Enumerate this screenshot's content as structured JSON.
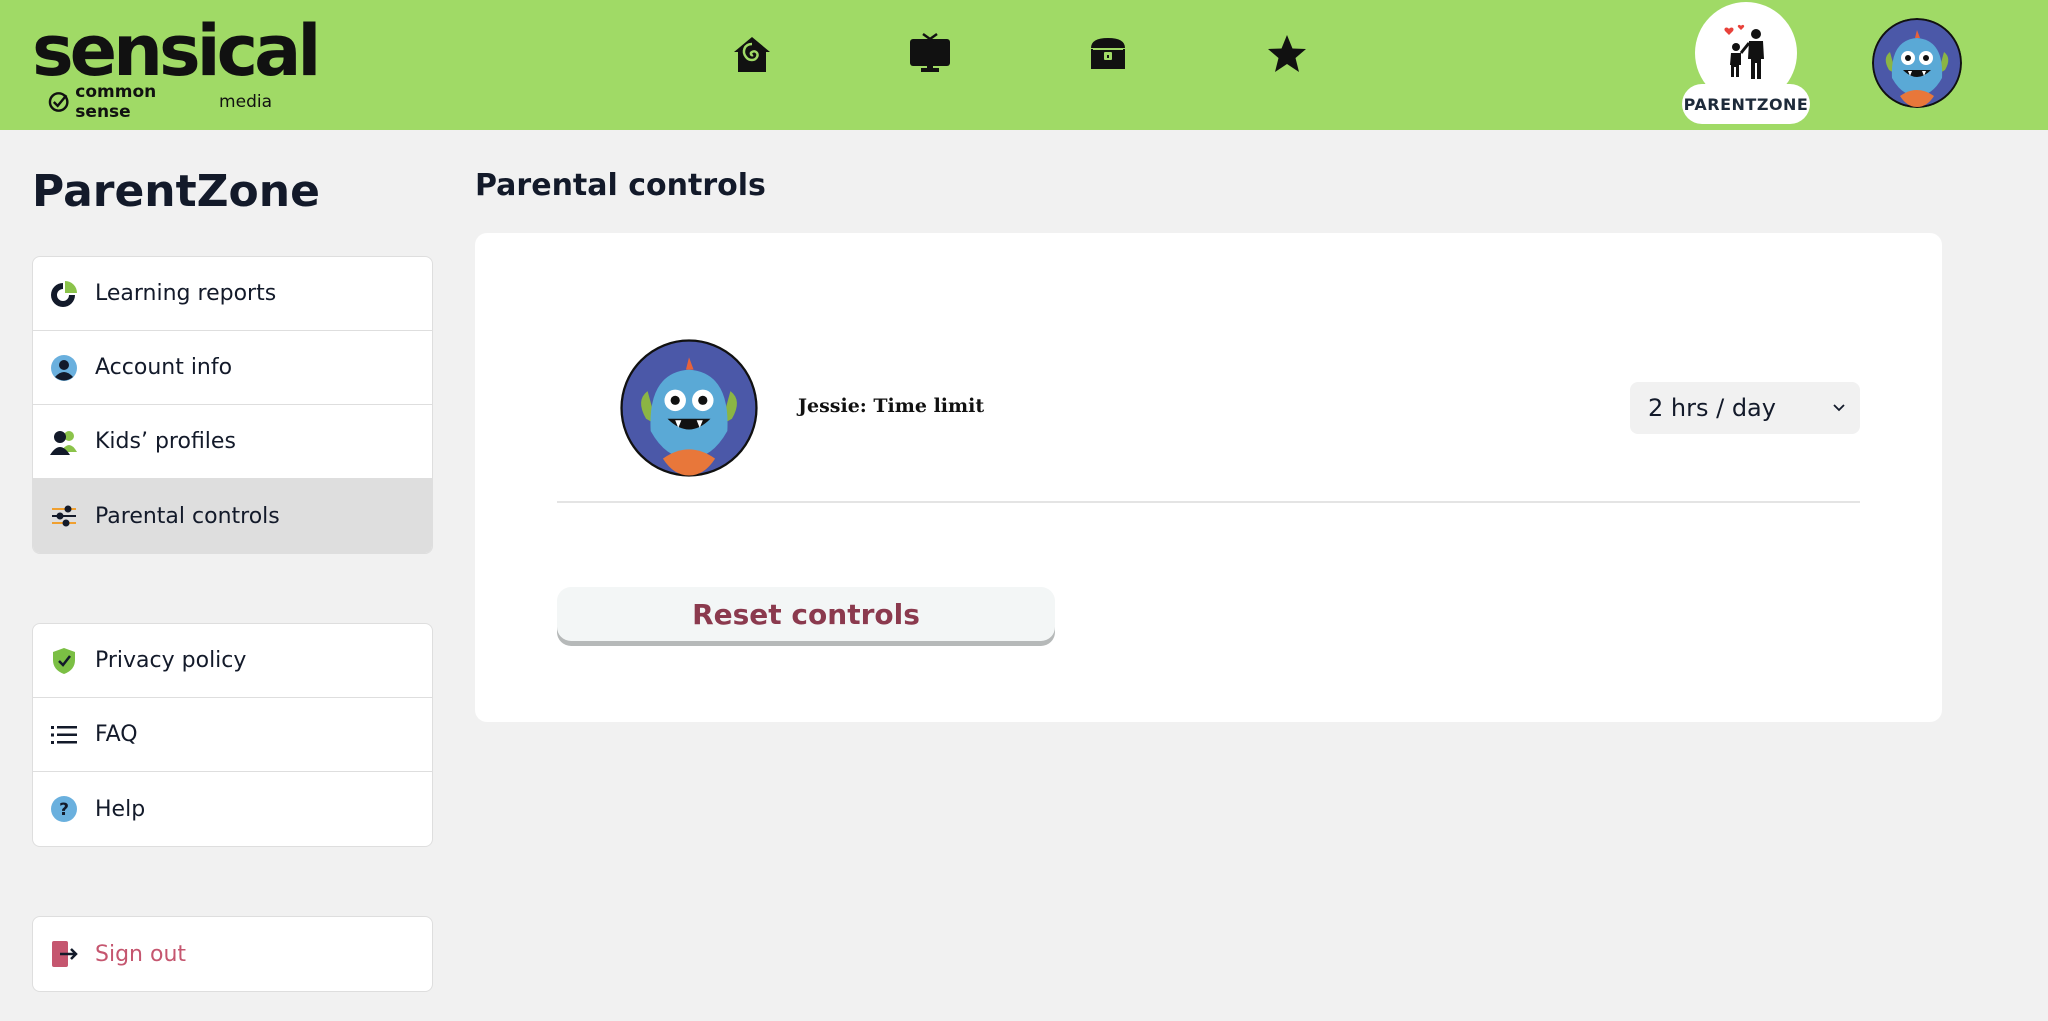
{
  "header": {
    "logo_main": "sensical",
    "logo_sub_brand": "common sense",
    "logo_sub_media": "media",
    "nav_icons": [
      "home-icon",
      "tv-icon",
      "treasure-chest-icon",
      "star-icon"
    ],
    "parentzone_label": "PARENTZONE",
    "bg_color": "#a0da66"
  },
  "sidebar": {
    "title": "ParentZone",
    "groups": [
      {
        "items": [
          {
            "label": "Learning reports",
            "icon": "pie-chart-icon"
          },
          {
            "label": "Account info",
            "icon": "user-circle-icon"
          },
          {
            "label": "Kids’ profiles",
            "icon": "people-icon"
          },
          {
            "label": "Parental controls",
            "icon": "sliders-icon",
            "active": true
          }
        ]
      },
      {
        "items": [
          {
            "label": "Privacy policy",
            "icon": "shield-check-icon"
          },
          {
            "label": "FAQ",
            "icon": "list-icon"
          },
          {
            "label": "Help",
            "icon": "question-circle-icon"
          }
        ]
      }
    ],
    "signout_label": "Sign out"
  },
  "main": {
    "title": "Parental controls",
    "kid": {
      "label": "Jessie: Time limit",
      "time_limit_value": "2 hrs / day"
    },
    "reset_label": "Reset controls"
  },
  "colors": {
    "accent_green": "#a0da66",
    "signout_pink": "#c5566f",
    "reset_text": "#8b3a4e"
  }
}
